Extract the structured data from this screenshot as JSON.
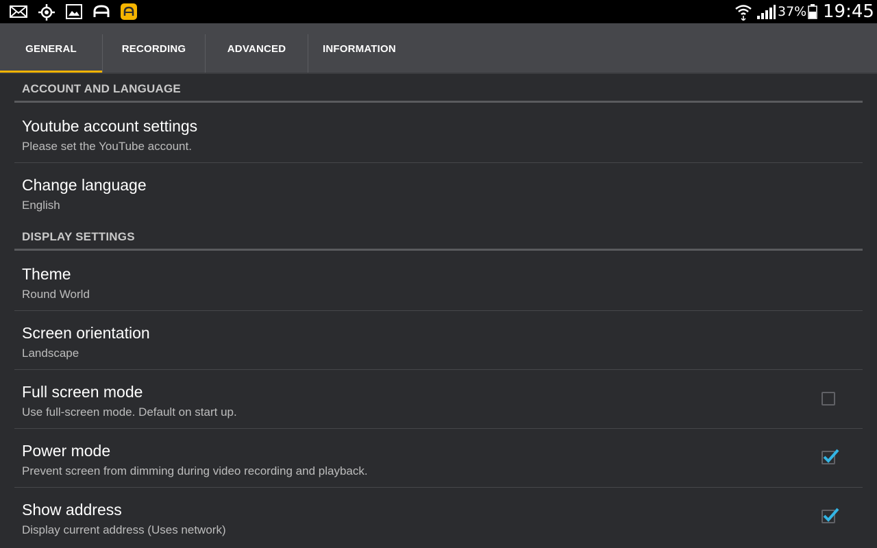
{
  "status_bar": {
    "battery_percent": "37%",
    "time": "19:45",
    "icons": [
      "mail-icon",
      "location-icon",
      "gallery-icon",
      "car-icon",
      "app-notification-icon",
      "wifi-icon",
      "signal-icon",
      "battery-icon"
    ]
  },
  "tabs": [
    {
      "label": "GENERAL",
      "active": true
    },
    {
      "label": "RECORDING",
      "active": false
    },
    {
      "label": "ADVANCED",
      "active": false
    },
    {
      "label": "INFORMATION",
      "active": false
    }
  ],
  "sections": [
    {
      "header": "ACCOUNT AND LANGUAGE"
    },
    {
      "header": "DISPLAY SETTINGS"
    }
  ],
  "settings": [
    {
      "title": "Youtube account settings",
      "summary": "Please set the YouTube account."
    },
    {
      "title": "Change language",
      "summary": "English"
    },
    {
      "title": "Theme",
      "summary": "Round World"
    },
    {
      "title": "Screen orientation",
      "summary": "Landscape"
    },
    {
      "title": "Full screen mode",
      "summary": "Use full-screen mode. Default on start up.",
      "checked": false
    },
    {
      "title": "Power mode",
      "summary": "Prevent screen from dimming during video recording and playback.",
      "checked": true
    },
    {
      "title": "Show address",
      "summary": "Display current address (Uses network)",
      "checked": true
    }
  ],
  "colors": {
    "accent": "#f5b400",
    "check": "#33b5e5",
    "background": "#2b2c2f",
    "tabbar": "#46474b"
  }
}
